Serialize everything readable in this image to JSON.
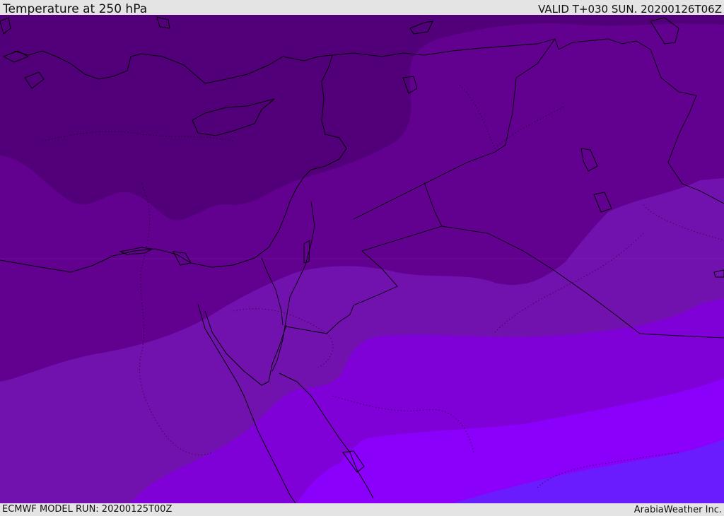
{
  "header": {
    "title": "Temperature at 250 hPa",
    "valid_time": "VALID T+030 SUN. 20200126T06Z"
  },
  "footer": {
    "model_run": "ECMWF MODEL RUN: 20200125T00Z",
    "credit": "ArabiaWeather Inc."
  },
  "map": {
    "field": "temperature",
    "level": "250 hPa",
    "colors": {
      "band_1": "#52007a",
      "band_2": "#620090",
      "band_3": "#7212ae",
      "band_4": "#8000d8",
      "band_5": "#8a00fa",
      "band_6": "#6a1cff",
      "coast": "#000000",
      "border": "#000000"
    }
  }
}
